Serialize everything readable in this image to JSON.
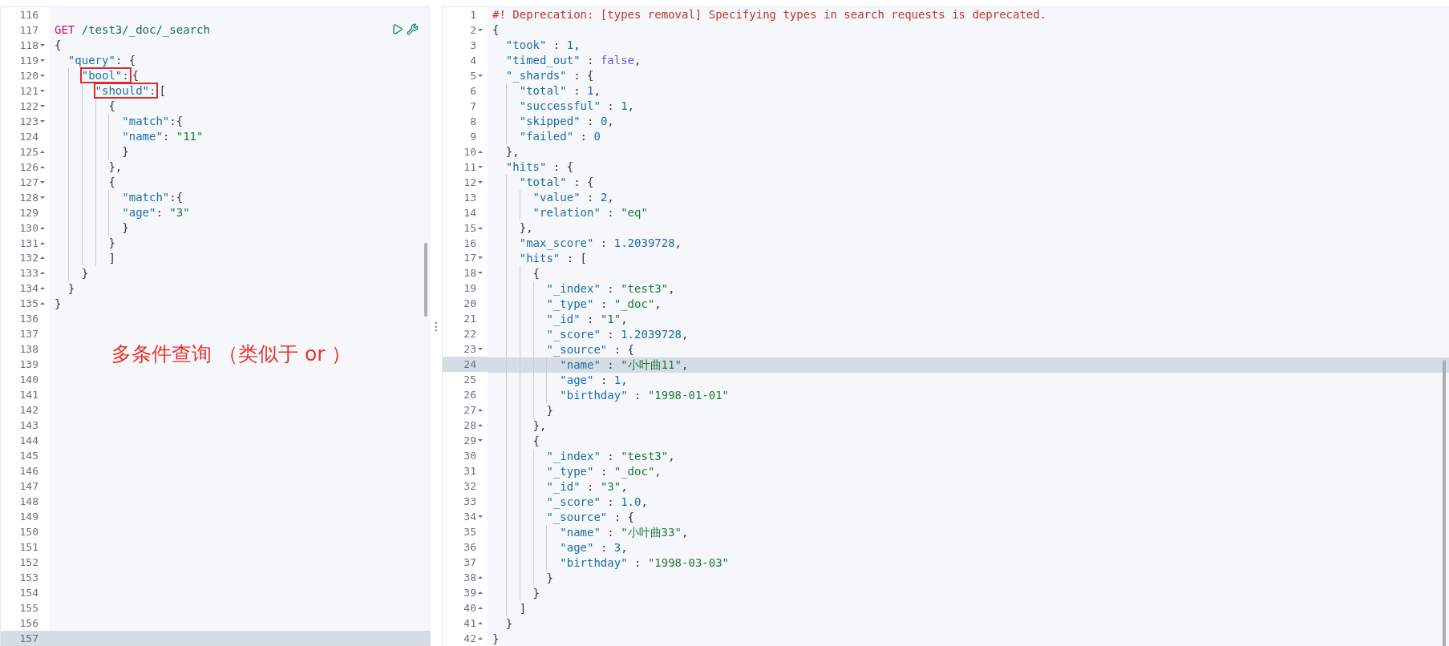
{
  "request_editor": {
    "annotation": "多条件查询 （类似于 or ）",
    "lines": [
      {
        "number": "116",
        "kind": "blank",
        "fold_start": false,
        "fold_end": false,
        "selected": false
      },
      {
        "number": "117",
        "kind": "request",
        "fold_start": false,
        "fold_end": false,
        "selected": false,
        "text": "GET /test3/_doc/_search"
      },
      {
        "number": "118",
        "kind": "json",
        "fold_start": true,
        "fold_end": false,
        "selected": false,
        "text": "{"
      },
      {
        "number": "119",
        "kind": "json",
        "fold_start": true,
        "fold_end": false,
        "selected": false,
        "text": "  \"query\": {"
      },
      {
        "number": "120",
        "kind": "json",
        "fold_start": true,
        "fold_end": false,
        "selected": false,
        "boxed": "    \"bool\":",
        "text": "{"
      },
      {
        "number": "121",
        "kind": "json",
        "fold_start": true,
        "fold_end": false,
        "selected": false,
        "boxed": "      \"should\":",
        "text": "["
      },
      {
        "number": "122",
        "kind": "json",
        "fold_start": true,
        "fold_end": false,
        "selected": false,
        "text": "        {"
      },
      {
        "number": "123",
        "kind": "json",
        "fold_start": true,
        "fold_end": false,
        "selected": false,
        "text": "          \"match\":{"
      },
      {
        "number": "124",
        "kind": "json",
        "fold_start": false,
        "fold_end": false,
        "selected": false,
        "text": "          \"name\": \"11\""
      },
      {
        "number": "125",
        "kind": "json",
        "fold_start": false,
        "fold_end": true,
        "selected": false,
        "text": "          }"
      },
      {
        "number": "126",
        "kind": "json",
        "fold_start": false,
        "fold_end": true,
        "selected": false,
        "text": "        },"
      },
      {
        "number": "127",
        "kind": "json",
        "fold_start": true,
        "fold_end": false,
        "selected": false,
        "text": "        {"
      },
      {
        "number": "128",
        "kind": "json",
        "fold_start": true,
        "fold_end": false,
        "selected": false,
        "text": "          \"match\":{"
      },
      {
        "number": "129",
        "kind": "json",
        "fold_start": false,
        "fold_end": false,
        "selected": false,
        "text": "          \"age\": \"3\""
      },
      {
        "number": "130",
        "kind": "json",
        "fold_start": false,
        "fold_end": true,
        "selected": false,
        "text": "          }"
      },
      {
        "number": "131",
        "kind": "json",
        "fold_start": false,
        "fold_end": true,
        "selected": false,
        "text": "        }"
      },
      {
        "number": "132",
        "kind": "json",
        "fold_start": false,
        "fold_end": true,
        "selected": false,
        "text": "        ]"
      },
      {
        "number": "133",
        "kind": "json",
        "fold_start": false,
        "fold_end": true,
        "selected": false,
        "text": "    }"
      },
      {
        "number": "134",
        "kind": "json",
        "fold_start": false,
        "fold_end": true,
        "selected": false,
        "text": "  }"
      },
      {
        "number": "135",
        "kind": "json",
        "fold_start": false,
        "fold_end": true,
        "selected": false,
        "text": "}"
      },
      {
        "number": "136",
        "kind": "blank",
        "fold_start": false,
        "fold_end": false,
        "selected": false
      },
      {
        "number": "137",
        "kind": "blank",
        "fold_start": false,
        "fold_end": false,
        "selected": false
      },
      {
        "number": "138",
        "kind": "blank",
        "fold_start": false,
        "fold_end": false,
        "selected": false
      },
      {
        "number": "139",
        "kind": "blank",
        "fold_start": false,
        "fold_end": false,
        "selected": false
      },
      {
        "number": "140",
        "kind": "blank",
        "fold_start": false,
        "fold_end": false,
        "selected": false
      },
      {
        "number": "141",
        "kind": "blank",
        "fold_start": false,
        "fold_end": false,
        "selected": false
      },
      {
        "number": "142",
        "kind": "blank",
        "fold_start": false,
        "fold_end": false,
        "selected": false
      },
      {
        "number": "143",
        "kind": "blank",
        "fold_start": false,
        "fold_end": false,
        "selected": false
      },
      {
        "number": "144",
        "kind": "blank",
        "fold_start": false,
        "fold_end": false,
        "selected": false
      },
      {
        "number": "145",
        "kind": "blank",
        "fold_start": false,
        "fold_end": false,
        "selected": false
      },
      {
        "number": "146",
        "kind": "blank",
        "fold_start": false,
        "fold_end": false,
        "selected": false
      },
      {
        "number": "147",
        "kind": "blank",
        "fold_start": false,
        "fold_end": false,
        "selected": false
      },
      {
        "number": "148",
        "kind": "blank",
        "fold_start": false,
        "fold_end": false,
        "selected": false
      },
      {
        "number": "149",
        "kind": "blank",
        "fold_start": false,
        "fold_end": false,
        "selected": false
      },
      {
        "number": "150",
        "kind": "blank",
        "fold_start": false,
        "fold_end": false,
        "selected": false
      },
      {
        "number": "151",
        "kind": "blank",
        "fold_start": false,
        "fold_end": false,
        "selected": false
      },
      {
        "number": "152",
        "kind": "blank",
        "fold_start": false,
        "fold_end": false,
        "selected": false
      },
      {
        "number": "153",
        "kind": "blank",
        "fold_start": false,
        "fold_end": false,
        "selected": false
      },
      {
        "number": "154",
        "kind": "blank",
        "fold_start": false,
        "fold_end": false,
        "selected": false
      },
      {
        "number": "155",
        "kind": "blank",
        "fold_start": false,
        "fold_end": false,
        "selected": false
      },
      {
        "number": "156",
        "kind": "blank",
        "fold_start": false,
        "fold_end": false,
        "selected": false
      },
      {
        "number": "157",
        "kind": "blank",
        "fold_start": false,
        "fold_end": false,
        "selected": true
      }
    ]
  },
  "resize_handle": "⋮",
  "response_viewer": {
    "lines": [
      {
        "number": "1",
        "kind": "comment",
        "fold_start": false,
        "fold_end": false,
        "selected": false,
        "text": "#! Deprecation: [types removal] Specifying types in search requests is deprecated."
      },
      {
        "number": "2",
        "kind": "json",
        "fold_start": true,
        "fold_end": false,
        "selected": false,
        "text": "{"
      },
      {
        "number": "3",
        "kind": "json",
        "fold_start": false,
        "fold_end": false,
        "selected": false,
        "text": "  \"took\" : 1,"
      },
      {
        "number": "4",
        "kind": "json",
        "fold_start": false,
        "fold_end": false,
        "selected": false,
        "text": "  \"timed_out\" : false,"
      },
      {
        "number": "5",
        "kind": "json",
        "fold_start": true,
        "fold_end": false,
        "selected": false,
        "text": "  \"_shards\" : {"
      },
      {
        "number": "6",
        "kind": "json",
        "fold_start": false,
        "fold_end": false,
        "selected": false,
        "text": "    \"total\" : 1,"
      },
      {
        "number": "7",
        "kind": "json",
        "fold_start": false,
        "fold_end": false,
        "selected": false,
        "text": "    \"successful\" : 1,"
      },
      {
        "number": "8",
        "kind": "json",
        "fold_start": false,
        "fold_end": false,
        "selected": false,
        "text": "    \"skipped\" : 0,"
      },
      {
        "number": "9",
        "kind": "json",
        "fold_start": false,
        "fold_end": false,
        "selected": false,
        "text": "    \"failed\" : 0"
      },
      {
        "number": "10",
        "kind": "json",
        "fold_start": false,
        "fold_end": true,
        "selected": false,
        "text": "  },"
      },
      {
        "number": "11",
        "kind": "json",
        "fold_start": true,
        "fold_end": false,
        "selected": false,
        "text": "  \"hits\" : {"
      },
      {
        "number": "12",
        "kind": "json",
        "fold_start": true,
        "fold_end": false,
        "selected": false,
        "text": "    \"total\" : {"
      },
      {
        "number": "13",
        "kind": "json",
        "fold_start": false,
        "fold_end": false,
        "selected": false,
        "text": "      \"value\" : 2,"
      },
      {
        "number": "14",
        "kind": "json",
        "fold_start": false,
        "fold_end": false,
        "selected": false,
        "text": "      \"relation\" : \"eq\""
      },
      {
        "number": "15",
        "kind": "json",
        "fold_start": false,
        "fold_end": true,
        "selected": false,
        "text": "    },"
      },
      {
        "number": "16",
        "kind": "json",
        "fold_start": false,
        "fold_end": false,
        "selected": false,
        "text": "    \"max_score\" : 1.2039728,"
      },
      {
        "number": "17",
        "kind": "json",
        "fold_start": true,
        "fold_end": false,
        "selected": false,
        "text": "    \"hits\" : ["
      },
      {
        "number": "18",
        "kind": "json",
        "fold_start": true,
        "fold_end": false,
        "selected": false,
        "text": "      {"
      },
      {
        "number": "19",
        "kind": "json",
        "fold_start": false,
        "fold_end": false,
        "selected": false,
        "text": "        \"_index\" : \"test3\","
      },
      {
        "number": "20",
        "kind": "json",
        "fold_start": false,
        "fold_end": false,
        "selected": false,
        "text": "        \"_type\" : \"_doc\","
      },
      {
        "number": "21",
        "kind": "json",
        "fold_start": false,
        "fold_end": false,
        "selected": false,
        "text": "        \"_id\" : \"1\","
      },
      {
        "number": "22",
        "kind": "json",
        "fold_start": false,
        "fold_end": false,
        "selected": false,
        "text": "        \"_score\" : 1.2039728,"
      },
      {
        "number": "23",
        "kind": "json",
        "fold_start": true,
        "fold_end": false,
        "selected": false,
        "text": "        \"_source\" : {"
      },
      {
        "number": "24",
        "kind": "json",
        "fold_start": false,
        "fold_end": false,
        "selected": true,
        "text": "          \"name\" : \"小叶曲11\","
      },
      {
        "number": "25",
        "kind": "json",
        "fold_start": false,
        "fold_end": false,
        "selected": false,
        "text": "          \"age\" : 1,"
      },
      {
        "number": "26",
        "kind": "json",
        "fold_start": false,
        "fold_end": false,
        "selected": false,
        "text": "          \"birthday\" : \"1998-01-01\""
      },
      {
        "number": "27",
        "kind": "json",
        "fold_start": false,
        "fold_end": true,
        "selected": false,
        "text": "        }"
      },
      {
        "number": "28",
        "kind": "json",
        "fold_start": false,
        "fold_end": true,
        "selected": false,
        "text": "      },"
      },
      {
        "number": "29",
        "kind": "json",
        "fold_start": true,
        "fold_end": false,
        "selected": false,
        "text": "      {"
      },
      {
        "number": "30",
        "kind": "json",
        "fold_start": false,
        "fold_end": false,
        "selected": false,
        "text": "        \"_index\" : \"test3\","
      },
      {
        "number": "31",
        "kind": "json",
        "fold_start": false,
        "fold_end": false,
        "selected": false,
        "text": "        \"_type\" : \"_doc\","
      },
      {
        "number": "32",
        "kind": "json",
        "fold_start": false,
        "fold_end": false,
        "selected": false,
        "text": "        \"_id\" : \"3\","
      },
      {
        "number": "33",
        "kind": "json",
        "fold_start": false,
        "fold_end": false,
        "selected": false,
        "text": "        \"_score\" : 1.0,"
      },
      {
        "number": "34",
        "kind": "json",
        "fold_start": true,
        "fold_end": false,
        "selected": false,
        "text": "        \"_source\" : {"
      },
      {
        "number": "35",
        "kind": "json",
        "fold_start": false,
        "fold_end": false,
        "selected": false,
        "text": "          \"name\" : \"小叶曲33\","
      },
      {
        "number": "36",
        "kind": "json",
        "fold_start": false,
        "fold_end": false,
        "selected": false,
        "text": "          \"age\" : 3,"
      },
      {
        "number": "37",
        "kind": "json",
        "fold_start": false,
        "fold_end": false,
        "selected": false,
        "text": "          \"birthday\" : \"1998-03-03\""
      },
      {
        "number": "38",
        "kind": "json",
        "fold_start": false,
        "fold_end": true,
        "selected": false,
        "text": "        }"
      },
      {
        "number": "39",
        "kind": "json",
        "fold_start": false,
        "fold_end": true,
        "selected": false,
        "text": "      }"
      },
      {
        "number": "40",
        "kind": "json",
        "fold_start": false,
        "fold_end": true,
        "selected": false,
        "text": "    ]"
      },
      {
        "number": "41",
        "kind": "json",
        "fold_start": false,
        "fold_end": true,
        "selected": false,
        "text": "  }"
      },
      {
        "number": "42",
        "kind": "json",
        "fold_start": false,
        "fold_end": true,
        "selected": false,
        "text": "}"
      }
    ]
  }
}
